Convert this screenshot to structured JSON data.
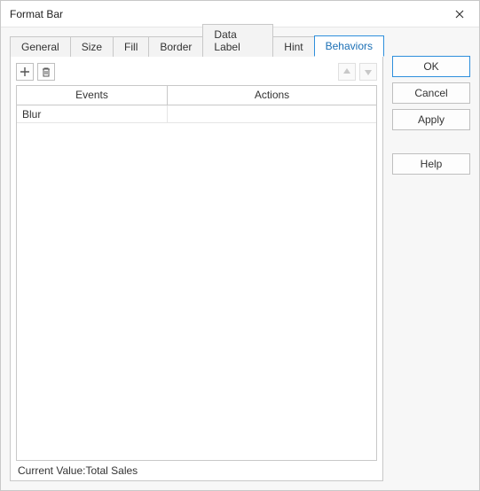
{
  "window": {
    "title": "Format Bar"
  },
  "tabs": [
    {
      "label": "General"
    },
    {
      "label": "Size"
    },
    {
      "label": "Fill"
    },
    {
      "label": "Border"
    },
    {
      "label": "Data Label"
    },
    {
      "label": "Hint"
    },
    {
      "label": "Behaviors",
      "active": true
    }
  ],
  "grid": {
    "headers": {
      "events": "Events",
      "actions": "Actions"
    },
    "rows": [
      {
        "event": "Blur",
        "action": ""
      }
    ]
  },
  "status": {
    "label": "Current Value:",
    "value": "Total Sales"
  },
  "buttons": {
    "ok": "OK",
    "cancel": "Cancel",
    "apply": "Apply",
    "help": "Help"
  }
}
